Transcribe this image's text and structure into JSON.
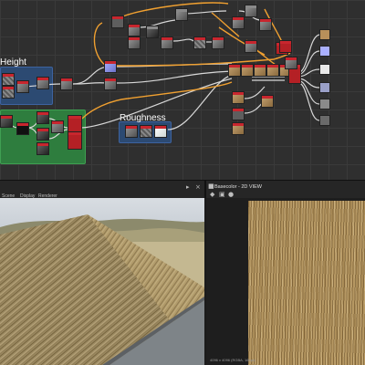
{
  "graph": {
    "frames": {
      "height_title": "Height",
      "roughness_title": "Roughness",
      "normal_title": ""
    }
  },
  "view3d_toolbar": {
    "menu_items": [
      "Scene",
      "Display",
      "Renderer"
    ]
  },
  "view2d_toolbar": {
    "title": "Basecolor - 2D VIEW"
  },
  "view2d": {
    "status_text": "4096 x 4096 (RGBA, 16bpc)"
  },
  "colors": {
    "graph_bg": "#2f2f2f",
    "height_frame": "#2c4a72",
    "normal_frame": "#2e7d3e",
    "roughness_frame": "#2c4a72",
    "link_orange": "#f0a030",
    "link_white": "#d8d8d8",
    "node_header_red": "#c8262e"
  },
  "icons": [
    "close-icon",
    "settings-icon",
    "camera-icon",
    "lock-icon",
    "fit-icon",
    "pin-icon"
  ]
}
